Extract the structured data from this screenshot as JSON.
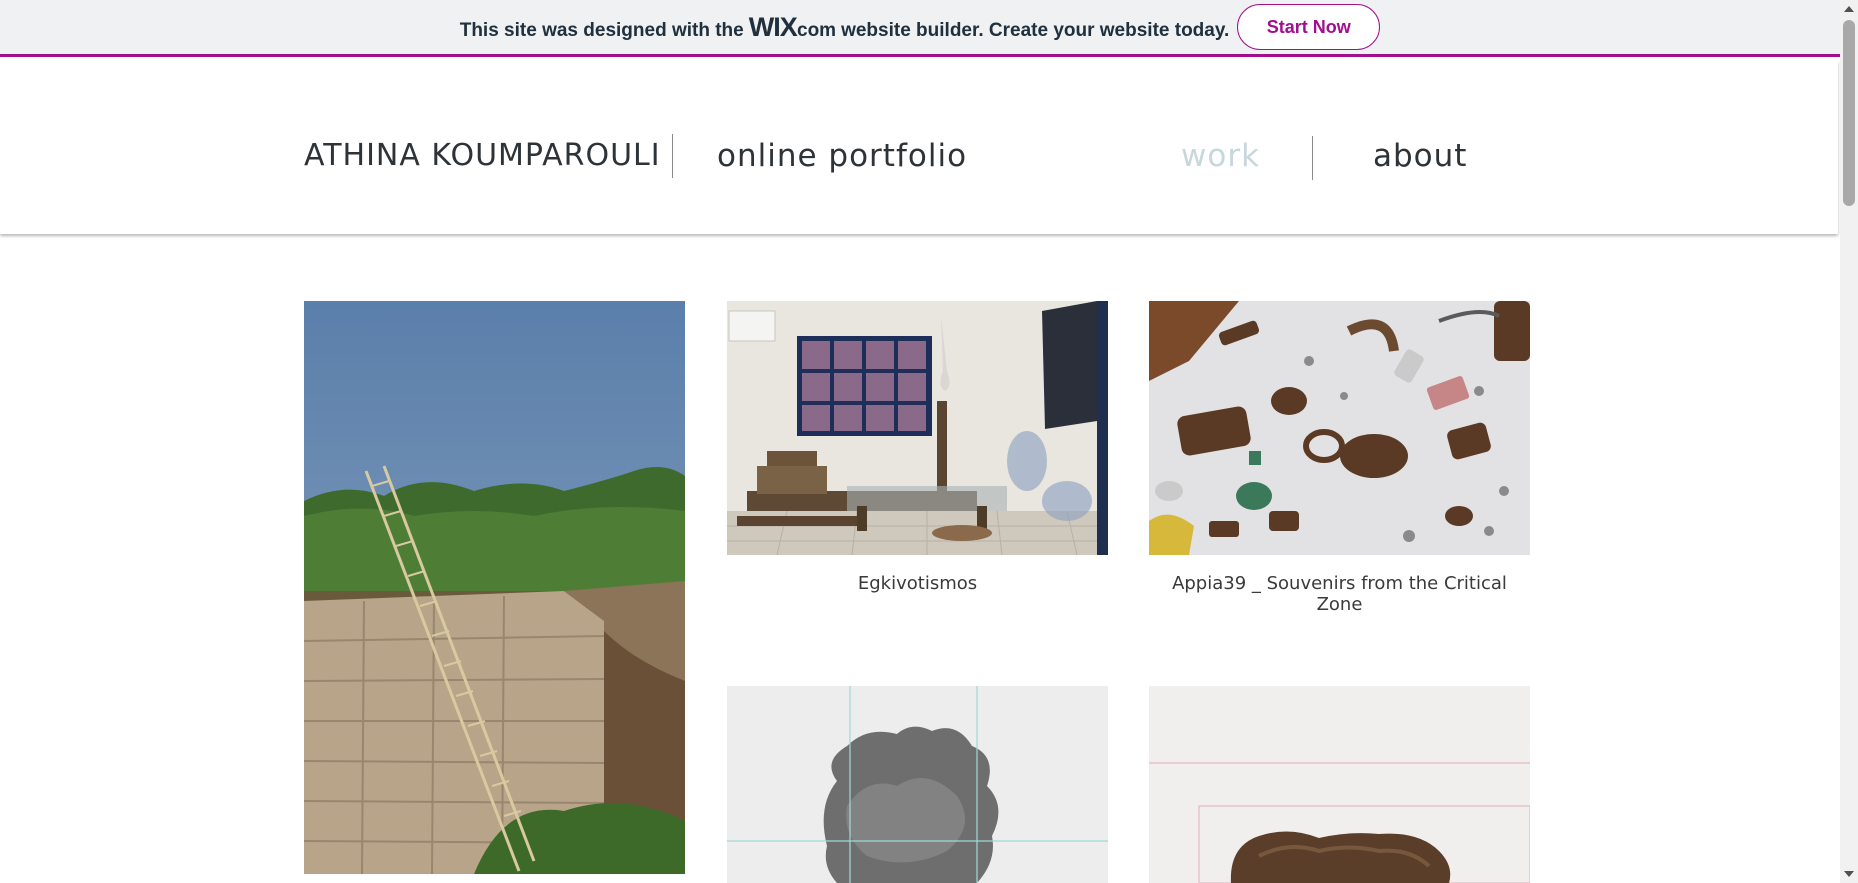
{
  "banner": {
    "text_before": "This site was designed with the",
    "logo": "WIX",
    "logo_suffix": ".com",
    "text_after": "website builder. Create your website today.",
    "cta_label": "Start Now"
  },
  "header": {
    "site_name": "ATHINA KOUMPAROULI",
    "tagline": "online portfolio",
    "nav": {
      "work": "work",
      "about": "about"
    }
  },
  "gallery": [
    {
      "caption": ""
    },
    {
      "caption": "Egkivotismos"
    },
    {
      "caption": "Appia39 _ Souvenirs from the Critical Zone"
    },
    {
      "caption": ""
    },
    {
      "caption": ""
    }
  ],
  "colors": {
    "wix_accent": "#a20f8e",
    "nav_active": "#c7d7dc",
    "text": "#2e3338"
  }
}
